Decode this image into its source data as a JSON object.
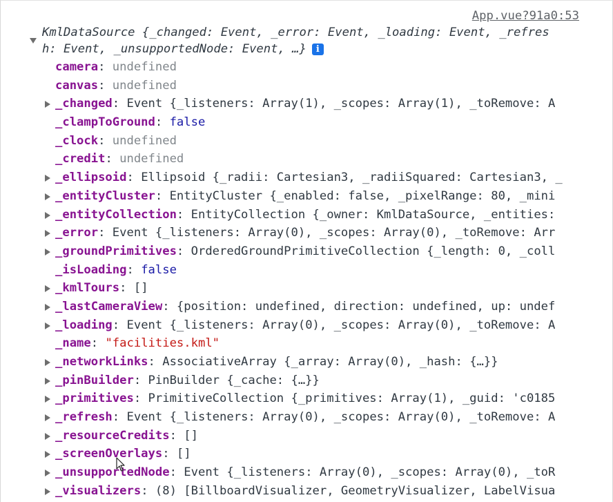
{
  "source_link": "App.vue?91a0:53",
  "header": {
    "line1": "KmlDataSource {_changed: Event, _error: Event, _loading: Event, _refres",
    "line2": "h: Event, _unsupportedNode: Event, …}",
    "info_icon": "i"
  },
  "colors": {
    "key": "#881391",
    "undefined": "#80868b",
    "boolean": "#1a1aa6",
    "string": "#c41a16",
    "info_icon_bg": "#1a73e8"
  },
  "properties": [
    {
      "key": "camera",
      "value": "undefined",
      "type": "undef",
      "expandable": false
    },
    {
      "key": "canvas",
      "value": "undefined",
      "type": "undef",
      "expandable": false
    },
    {
      "key": "_changed",
      "value": "Event {_listeners: Array(1), _scopes: Array(1), _toRemove: A",
      "type": "obj",
      "expandable": true
    },
    {
      "key": "_clampToGround",
      "value": "false",
      "type": "bool",
      "expandable": false
    },
    {
      "key": "_clock",
      "value": "undefined",
      "type": "undef",
      "expandable": false
    },
    {
      "key": "_credit",
      "value": "undefined",
      "type": "undef",
      "expandable": false
    },
    {
      "key": "_ellipsoid",
      "value": "Ellipsoid {_radii: Cartesian3, _radiiSquared: Cartesian3, _",
      "type": "obj",
      "expandable": true
    },
    {
      "key": "_entityCluster",
      "value": "EntityCluster {_enabled: false, _pixelRange: 80, _mini",
      "type": "obj",
      "expandable": true
    },
    {
      "key": "_entityCollection",
      "value": "EntityCollection {_owner: KmlDataSource, _entities:",
      "type": "obj",
      "expandable": true
    },
    {
      "key": "_error",
      "value": "Event {_listeners: Array(0), _scopes: Array(0), _toRemove: Arr",
      "type": "obj",
      "expandable": true
    },
    {
      "key": "_groundPrimitives",
      "value": "OrderedGroundPrimitiveCollection {_length: 0, _coll",
      "type": "obj",
      "expandable": true
    },
    {
      "key": "_isLoading",
      "value": "false",
      "type": "bool",
      "expandable": false
    },
    {
      "key": "_kmlTours",
      "value": "[]",
      "type": "obj",
      "expandable": true
    },
    {
      "key": "_lastCameraView",
      "value": "{position: undefined, direction: undefined, up: undef",
      "type": "obj",
      "expandable": true
    },
    {
      "key": "_loading",
      "value": "Event {_listeners: Array(0), _scopes: Array(0), _toRemove: A",
      "type": "obj",
      "expandable": true
    },
    {
      "key": "_name",
      "value": "\"facilities.kml\"",
      "type": "str",
      "expandable": false
    },
    {
      "key": "_networkLinks",
      "value": "AssociativeArray {_array: Array(0), _hash: {…}}",
      "type": "obj",
      "expandable": true
    },
    {
      "key": "_pinBuilder",
      "value": "PinBuilder {_cache: {…}}",
      "type": "obj",
      "expandable": true
    },
    {
      "key": "_primitives",
      "value": "PrimitiveCollection {_primitives: Array(1), _guid: 'c0185",
      "type": "obj",
      "expandable": true
    },
    {
      "key": "_refresh",
      "value": "Event {_listeners: Array(0), _scopes: Array(0), _toRemove: A",
      "type": "obj",
      "expandable": true
    },
    {
      "key": "_resourceCredits",
      "value": "[]",
      "type": "obj",
      "expandable": true
    },
    {
      "key": "_screenOverlays",
      "value": "[]",
      "type": "obj",
      "expandable": true
    },
    {
      "key": "_unsupportedNode",
      "value": "Event {_listeners: Array(0), _scopes: Array(0), _toR",
      "type": "obj",
      "expandable": true
    },
    {
      "key": "_visualizers",
      "value": "(8) [BillboardVisualizer, GeometryVisualizer, LabelVisua",
      "type": "obj",
      "expandable": true
    }
  ]
}
